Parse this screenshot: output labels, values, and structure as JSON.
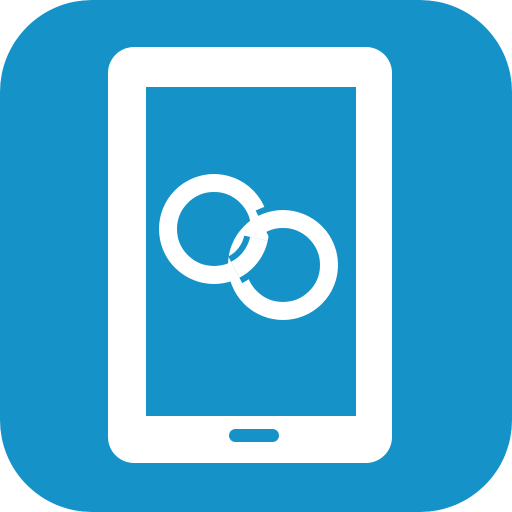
{
  "icon": {
    "name": "tablet-link-app-icon",
    "background_color": "#1592C8",
    "foreground_color": "#FFFFFF",
    "device_icon": "tablet-icon",
    "symbol_icon": "interlocking-rings-icon"
  }
}
